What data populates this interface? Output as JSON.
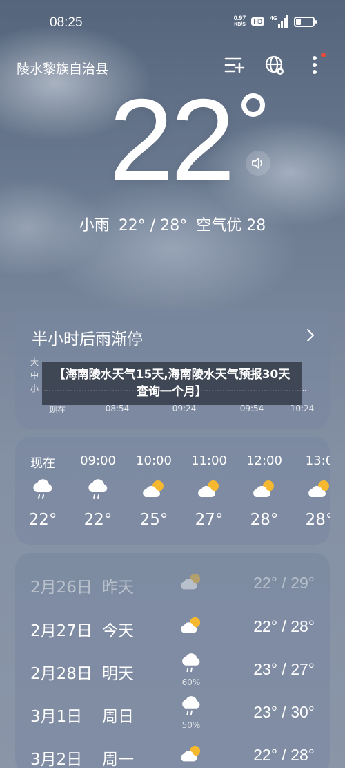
{
  "status_bar": {
    "time": "08:25",
    "net_speed_value": "0.97",
    "net_speed_unit": "KB/S",
    "hd": "HD",
    "network": "4G",
    "battery_level": 0.3
  },
  "header": {
    "location": "陵水黎族自治县",
    "icons": [
      "city-list-icon",
      "globe-icon",
      "more-icon"
    ]
  },
  "current": {
    "temperature": "22",
    "condition": "小雨",
    "range": "22° / 28°",
    "air_quality": "空气优 28"
  },
  "rain_card": {
    "title": "半小时后雨渐停",
    "y_labels": [
      "大",
      "中",
      "小"
    ],
    "x_labels": [
      "现在",
      "08:54",
      "09:24",
      "09:54",
      "10:24"
    ]
  },
  "banner": {
    "text": "【海南陵水天气15天,海南陵水天气预报30天查询一个月】"
  },
  "hourly": [
    {
      "time": "现在",
      "icon": "rain",
      "temp": "22°"
    },
    {
      "time": "09:00",
      "icon": "rain",
      "temp": "22°"
    },
    {
      "time": "10:00",
      "icon": "partly-cloudy",
      "temp": "25°"
    },
    {
      "time": "11:00",
      "icon": "partly-cloudy",
      "temp": "27°"
    },
    {
      "time": "12:00",
      "icon": "partly-cloudy",
      "temp": "28°"
    },
    {
      "time": "13:0",
      "icon": "partly-cloudy",
      "temp": "28°"
    }
  ],
  "daily": [
    {
      "date": "2月26日",
      "rel": "昨天",
      "icon": "partly-cloudy",
      "pct": "",
      "range": "22° / 29°",
      "past": true
    },
    {
      "date": "2月27日",
      "rel": "今天",
      "icon": "partly-cloudy",
      "pct": "",
      "range": "22° / 28°",
      "past": false
    },
    {
      "date": "2月28日",
      "rel": "明天",
      "icon": "rain",
      "pct": "60%",
      "range": "23° / 27°",
      "past": false
    },
    {
      "date": "3月1日",
      "rel": "周日",
      "icon": "rain",
      "pct": "50%",
      "range": "23° / 30°",
      "past": false
    },
    {
      "date": "3月2日",
      "rel": "周一",
      "icon": "partly-cloudy",
      "pct": "",
      "range": "22° / 28°",
      "past": false
    }
  ],
  "colors": {
    "sun": "#f5b82e",
    "cloud": "#ffffff",
    "card": "#7887a0",
    "notification": "#e84a3c"
  }
}
